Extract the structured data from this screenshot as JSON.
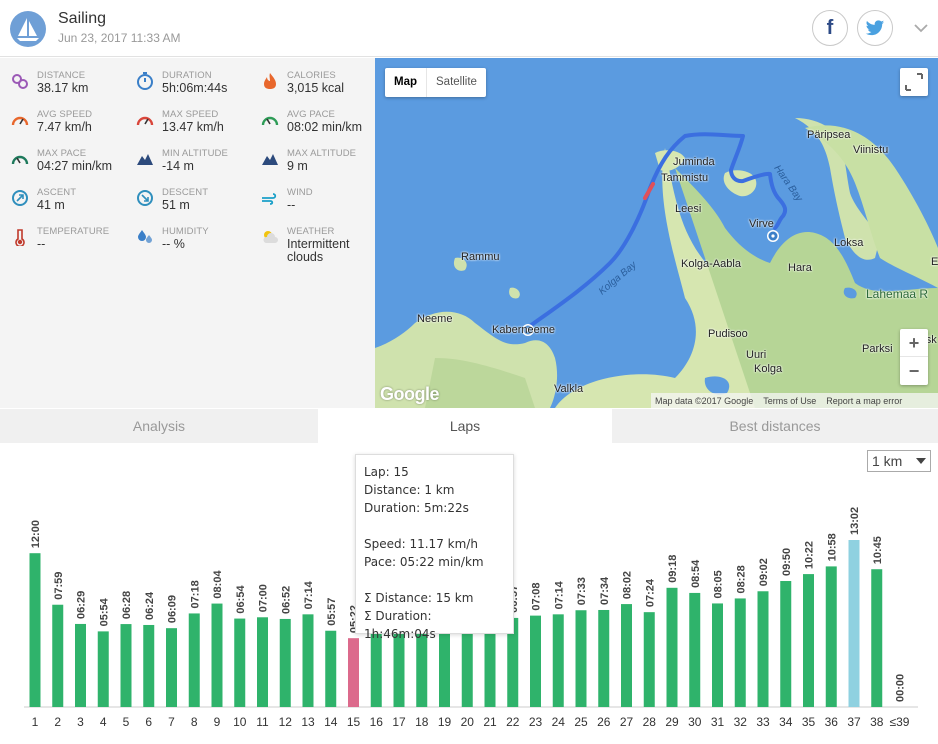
{
  "header": {
    "title": "Sailing",
    "date": "Jun 23, 2017 11:33 AM",
    "icon": "sailboat-icon",
    "social": [
      "facebook-icon",
      "twitter-icon"
    ]
  },
  "stats": [
    {
      "label": "DISTANCE",
      "value": "38.17 km",
      "icon": "distance-icon",
      "color": "#9b59b6"
    },
    {
      "label": "DURATION",
      "value": "5h:06m:44s",
      "icon": "stopwatch-icon",
      "color": "#3a7fc8"
    },
    {
      "label": "CALORIES",
      "value": "3,015 kcal",
      "icon": "flame-icon",
      "color": "#e8672c"
    },
    {
      "label": "AVG SPEED",
      "value": "7.47 km/h",
      "icon": "speedometer-icon",
      "color": "#e8672c"
    },
    {
      "label": "MAX SPEED",
      "value": "13.47 km/h",
      "icon": "speedometer-icon",
      "color": "#d9453a"
    },
    {
      "label": "AVG PACE",
      "value": "08:02 min/km",
      "icon": "pace-gauge-icon",
      "color": "#2e9c57"
    },
    {
      "label": "MAX PACE",
      "value": "04:27 min/km",
      "icon": "pace-gauge-icon",
      "color": "#1e7a5c"
    },
    {
      "label": "MIN ALTITUDE",
      "value": "-14 m",
      "icon": "mountain-icon",
      "color": "#2c4a7c"
    },
    {
      "label": "MAX ALTITUDE",
      "value": "9 m",
      "icon": "mountain-icon",
      "color": "#2c4a7c"
    },
    {
      "label": "ASCENT",
      "value": "41 m",
      "icon": "ascent-icon",
      "color": "#2f8fbd"
    },
    {
      "label": "DESCENT",
      "value": "51 m",
      "icon": "descent-icon",
      "color": "#2f8fbd"
    },
    {
      "label": "WIND",
      "value": "--",
      "icon": "wind-icon",
      "color": "#1aa0c8"
    },
    {
      "label": "TEMPERATURE",
      "value": "--",
      "icon": "thermometer-icon",
      "color": "#c0392b"
    },
    {
      "label": "HUMIDITY",
      "value": "-- %",
      "icon": "droplets-icon",
      "color": "#3a7fc8"
    },
    {
      "label": "WEATHER",
      "value": "Intermittent clouds",
      "icon": "partly-cloudy-icon",
      "color": "#f1c40f"
    }
  ],
  "map": {
    "map_btn": "Map",
    "satellite_btn": "Satellite",
    "zoom_in": "+",
    "zoom_out": "−",
    "google": "Google",
    "map_data": "Map data ©2017 Google",
    "terms": "Terms of Use",
    "report": "Report a map error",
    "places": [
      "Päripsea",
      "Viinistu",
      "Juminda",
      "Tammistu",
      "Leesi",
      "Virve",
      "Loksa",
      "Hara",
      "Rammu",
      "Kolga-Aabla",
      "Lahemaa R",
      "Neeme",
      "Kaberneeme",
      "Pudisoo",
      "Parksi",
      "Uuri",
      "Kolga",
      "Valkla",
      "E",
      "Jõesk"
    ],
    "waters": [
      "Hara Bay",
      "Kolga Bay"
    ],
    "route_color": "#3b6fe0",
    "highlight_color": "#e0505a"
  },
  "tabs": [
    {
      "label": "Analysis",
      "active": false
    },
    {
      "label": "Laps",
      "active": true
    },
    {
      "label": "Best distances",
      "active": false
    }
  ],
  "unit_select": "1 km",
  "tooltip": {
    "lap": "Lap: 15",
    "distance": "Distance: 1 km",
    "duration": "Duration: 5m:22s",
    "speed": "Speed: 11.17 km/h",
    "pace": "Pace: 05:22 min/km",
    "sum_distance": "Σ Distance: 15 km",
    "sum_duration": "Σ Duration: 1h:46m:04s"
  },
  "chart_data": {
    "type": "bar",
    "categories": [
      "1",
      "2",
      "3",
      "4",
      "5",
      "6",
      "7",
      "8",
      "9",
      "10",
      "11",
      "12",
      "13",
      "14",
      "15",
      "16",
      "17",
      "18",
      "19",
      "20",
      "21",
      "22",
      "23",
      "24",
      "25",
      "26",
      "27",
      "28",
      "29",
      "30",
      "31",
      "32",
      "33",
      "34",
      "35",
      "36",
      "37",
      "38",
      "≤39"
    ],
    "labels": [
      "12:00",
      "07:59",
      "06:29",
      "05:54",
      "06:28",
      "06:24",
      "06:09",
      "07:18",
      "08:04",
      "06:54",
      "07:00",
      "06:52",
      "07:14",
      "05:57",
      "05:22",
      "",
      "",
      "",
      "",
      "",
      "",
      "06:57",
      "07:08",
      "07:14",
      "07:33",
      "07:34",
      "08:02",
      "07:24",
      "09:18",
      "08:54",
      "08:05",
      "08:28",
      "09:02",
      "09:50",
      "10:22",
      "10:58",
      "13:02",
      "10:45",
      "00:00"
    ],
    "values": [
      12.0,
      7.98,
      6.48,
      5.9,
      6.47,
      6.4,
      6.15,
      7.3,
      8.07,
      6.9,
      7.0,
      6.87,
      7.23,
      5.95,
      5.37,
      7.6,
      7.7,
      7.6,
      7.7,
      7.6,
      7.7,
      6.95,
      7.13,
      7.23,
      7.55,
      7.57,
      8.03,
      7.4,
      9.3,
      8.9,
      8.08,
      8.47,
      9.03,
      9.83,
      10.37,
      10.97,
      13.03,
      10.75,
      0
    ],
    "colors": {
      "default": "#2fb36b",
      "selected": "#dc6a8c",
      "best": "#8fd1e0"
    },
    "selected_index": 14,
    "highlight_index": 36,
    "ylabel": "",
    "xlabel": ""
  }
}
